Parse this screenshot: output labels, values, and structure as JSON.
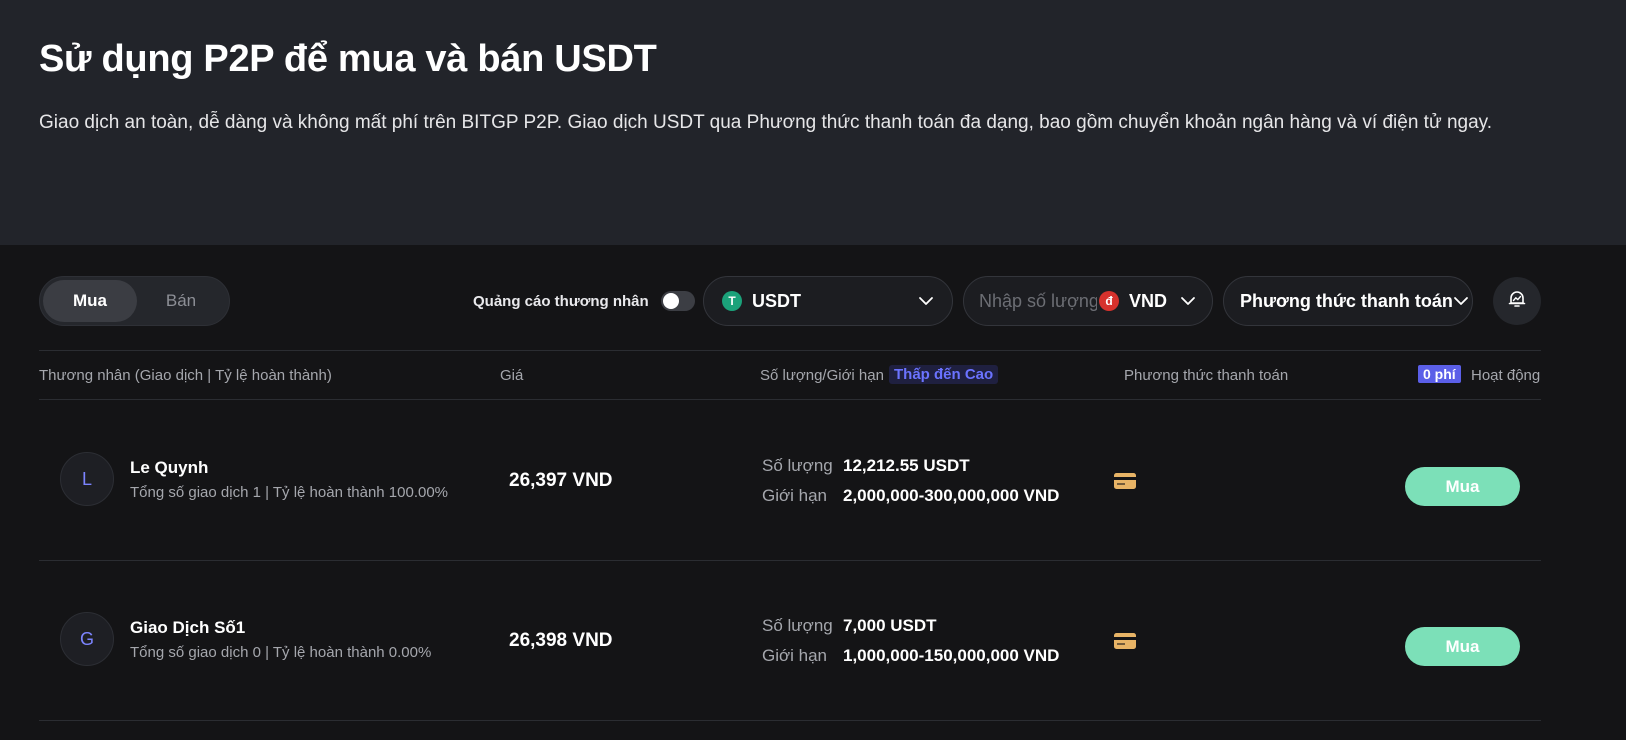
{
  "hero": {
    "title": "Sử dụng P2P để mua và bán USDT",
    "description": "Giao dịch an toàn, dễ dàng và không mất phí trên BITGP P2P. Giao dịch USDT qua Phương thức thanh toán đa dạng, bao gồm chuyển khoản ngân hàng và ví điện tử ngay."
  },
  "toolbar": {
    "buy_tab": "Mua",
    "sell_tab": "Bán",
    "merchant_ads_label": "Quảng cáo thương nhân",
    "merchant_ads_enabled": false,
    "coin": {
      "icon_glyph": "T",
      "label": "USDT",
      "icon_color": "#1ba27a"
    },
    "amount": {
      "placeholder": "Nhập số lượng mua",
      "value": ""
    },
    "fiat": {
      "icon_glyph": "đ",
      "label": "VND",
      "icon_color": "#d6322d"
    },
    "payment_method_label": "Phương thức thanh toán",
    "alert_icon": "bell-chart-icon"
  },
  "table": {
    "headers": {
      "merchant": "Thương nhân (Giao dịch | Tỷ lệ hoàn thành)",
      "price": "Giá",
      "amount_limit": "Số lượng/Giới hạn",
      "sort": "Thấp đến Cao",
      "payment_method": "Phương thức thanh toán",
      "fee_badge": "0 phí",
      "action": "Hoạt động"
    },
    "rows": [
      {
        "avatar_initial": "L",
        "name": "Le Quynh",
        "stats": "Tổng số giao dịch 1 | Tỷ lệ hoàn thành 100.00%",
        "price": "26,397 VND",
        "quantity_label": "Số lượng",
        "quantity": "12,212.55 USDT",
        "limit_label": "Giới hạn",
        "limit": "2,000,000-300,000,000 VND",
        "payment_icon": "bank-card-icon",
        "action_label": "Mua"
      },
      {
        "avatar_initial": "G",
        "name": "Giao Dịch Số1",
        "stats": "Tổng số giao dịch 0 | Tỷ lệ hoàn thành 0.00%",
        "price": "26,398 VND",
        "quantity_label": "Số lượng",
        "quantity": "7,000 USDT",
        "limit_label": "Giới hạn",
        "limit": "1,000,000-150,000,000 VND",
        "payment_icon": "bank-card-icon",
        "action_label": "Mua"
      }
    ]
  },
  "colors": {
    "accent_buy": "#7ce0b8",
    "sort_badge": "#6b73ff",
    "fee_badge": "#5b5fe8",
    "payment_icon": "#e8b466"
  }
}
